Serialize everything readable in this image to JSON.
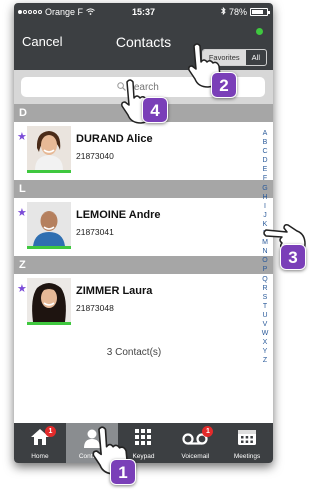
{
  "status_bar": {
    "carrier": "Orange F",
    "time": "15:37",
    "battery_percent_text": "78%",
    "battery_level": 0.78
  },
  "nav": {
    "cancel_label": "Cancel",
    "title": "Contacts",
    "presence_color": "#3fc83f",
    "segments": [
      "Favorites",
      "All"
    ],
    "active_segment": "Favorites"
  },
  "search": {
    "placeholder": "Search"
  },
  "sections": [
    {
      "letter": "D",
      "contacts": [
        {
          "name": "DURAND Alice",
          "number": "21873040",
          "favorite": true
        }
      ]
    },
    {
      "letter": "L",
      "contacts": [
        {
          "name": "LEMOINE Andre",
          "number": "21873041",
          "favorite": true
        }
      ]
    },
    {
      "letter": "Z",
      "contacts": [
        {
          "name": "ZIMMER Laura",
          "number": "21873048",
          "favorite": true
        }
      ]
    }
  ],
  "contact_count_label": "3 Contact(s)",
  "alpha_index": [
    "A",
    "B",
    "C",
    "D",
    "E",
    "F",
    "G",
    "H",
    "I",
    "J",
    "K",
    "L",
    "M",
    "N",
    "O",
    "P",
    "Q",
    "R",
    "S",
    "T",
    "U",
    "V",
    "W",
    "X",
    "Y",
    "Z"
  ],
  "tabs": [
    {
      "label": "Home",
      "icon": "home-icon",
      "badge": "1",
      "active": false
    },
    {
      "label": "Contacts",
      "icon": "person-icon",
      "badge": "",
      "active": true
    },
    {
      "label": "Keypad",
      "icon": "keypad-icon",
      "badge": "",
      "active": false
    },
    {
      "label": "Voicemail",
      "icon": "voicemail-icon",
      "badge": "1",
      "active": false
    },
    {
      "label": "Meetings",
      "icon": "calendar-icon",
      "badge": "",
      "active": false
    }
  ],
  "callouts": [
    {
      "number": "1",
      "icon": "pointing-hand-icon"
    },
    {
      "number": "2",
      "icon": "pointing-hand-icon"
    },
    {
      "number": "3",
      "icon": "pointing-hand-icon"
    },
    {
      "number": "4",
      "icon": "pointing-hand-icon"
    }
  ],
  "colors": {
    "bar_dark": "#3c3f42",
    "section_header": "#a6a6a6",
    "favorite_star": "#7b4bd8",
    "online_green": "#3fc83f",
    "badge_red": "#e32b2b",
    "callout_purple": "#7a3fb8"
  }
}
